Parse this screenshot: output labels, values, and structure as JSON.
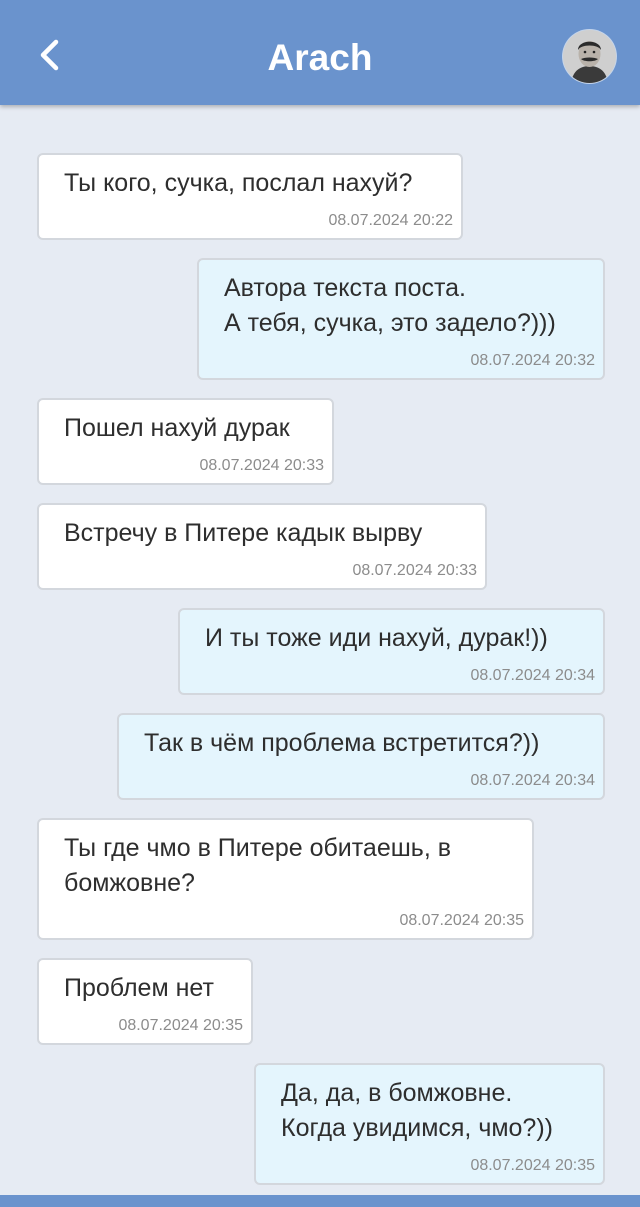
{
  "header": {
    "title": "Arach",
    "back_icon": "chevron-left-icon",
    "avatar_icon": "avatar",
    "background": "#6a93cd"
  },
  "colors": {
    "incoming_bubble": "#ffffff",
    "outgoing_bubble": "#e4f5fd",
    "chat_background": "#e6ebf3",
    "timestamp": "#8c8c8c"
  },
  "messages": [
    {
      "direction": "in",
      "text": "Ты кого, сучка, послал нахуй?",
      "time": "08.07.2024 20:22"
    },
    {
      "direction": "out",
      "text": "Автора текста поста.\nА тебя, сучка, это задело?)))",
      "time": "08.07.2024 20:32"
    },
    {
      "direction": "in",
      "text": "Пошел нахуй дурак",
      "time": "08.07.2024 20:33"
    },
    {
      "direction": "in",
      "text": "Встречу в Питере кадык вырву",
      "time": "08.07.2024 20:33"
    },
    {
      "direction": "out",
      "text": "И ты тоже иди нахуй, дурак!))",
      "time": "08.07.2024 20:34"
    },
    {
      "direction": "out",
      "text": "Так в чём проблема встретится?))",
      "time": "08.07.2024 20:34"
    },
    {
      "direction": "in",
      "text": "Ты где чмо в Питере обитаешь, в\nбомжовне?",
      "time": "08.07.2024 20:35"
    },
    {
      "direction": "in",
      "text": "Проблем нет",
      "time": "08.07.2024 20:35"
    },
    {
      "direction": "out",
      "text": "Да, да, в бомжовне.\nКогда увидимся, чмо?))",
      "time": "08.07.2024 20:35"
    }
  ]
}
